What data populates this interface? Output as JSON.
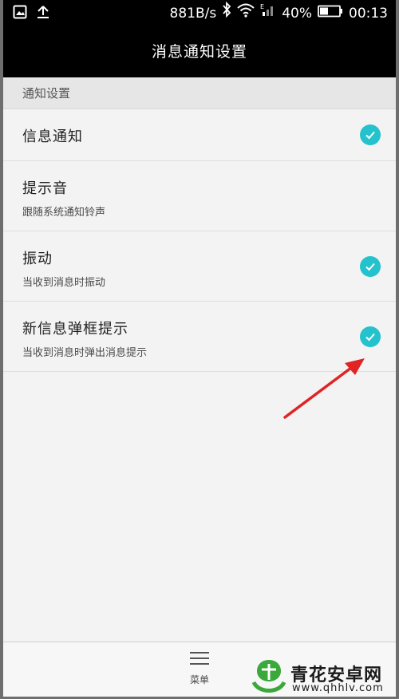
{
  "status_bar": {
    "net_speed": "881B/s",
    "network_type": "E",
    "battery": "40%",
    "time": "00:13",
    "icons": [
      "image-icon",
      "upload-icon",
      "bluetooth-icon",
      "wifi-icon",
      "signal-icon",
      "battery-icon"
    ]
  },
  "title_bar": {
    "title": "消息通知设置"
  },
  "section": {
    "header": "通知设置"
  },
  "items": [
    {
      "label": "信息通知",
      "sub": "",
      "checked": true
    },
    {
      "label": "提示音",
      "sub": "跟随系统通知铃声",
      "checked": false
    },
    {
      "label": "振动",
      "sub": "当收到消息时振动",
      "checked": true
    },
    {
      "label": "新信息弹框提示",
      "sub": "当收到消息时弹出消息提示",
      "checked": true
    }
  ],
  "bottom_bar": {
    "menu_label": "菜单"
  },
  "watermark": {
    "title": "青花安卓网",
    "url": "www.qhhlv.com"
  },
  "colors": {
    "accent": "#24c2cd",
    "bar_background": "#000000",
    "arrow": "#e02424"
  }
}
